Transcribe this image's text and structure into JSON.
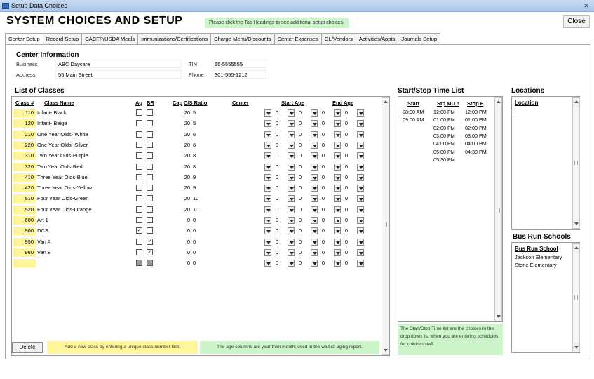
{
  "window": {
    "title": "Setup Data Choices",
    "close_glyph": "✕"
  },
  "header": {
    "title": "SYSTEM CHOICES AND SETUP",
    "hint": "Please click the Tab Headings to see additional setup choices.",
    "close_label": "Close"
  },
  "tabs": [
    {
      "label": "Center Setup",
      "active": true
    },
    {
      "label": "Record Setup"
    },
    {
      "label": "CACFP/USDA Meals"
    },
    {
      "label": "Immunizations/Certifications"
    },
    {
      "label": "Charge Menu/Discounts"
    },
    {
      "label": "Center Expenses"
    },
    {
      "label": "GL/Vendors"
    },
    {
      "label": "Activities/Appts"
    },
    {
      "label": "Journals Setup"
    }
  ],
  "center_info": {
    "heading": "Center Information",
    "business_label": "Business",
    "business": "ABC Daycare",
    "address_label": "Address",
    "address": "55 Main Street",
    "tin_label": "TIN",
    "tin": "55-5555555",
    "phone_label": "Phone",
    "phone": "301-555-1212"
  },
  "classes": {
    "heading": "List of Classes",
    "columns": {
      "class_num": "Class #",
      "class_name": "Class Name",
      "ag": "Ag",
      "br": "BR",
      "cap": "Cap",
      "ratio": "C/S Ratio",
      "center": "Center",
      "start_age": "Start Age",
      "end_age": "End Age"
    },
    "rows": [
      {
        "num": "110",
        "name": "Infant- Black",
        "ag": false,
        "br": false,
        "cap": "20",
        "ratio": "5",
        "sa_y": "0",
        "sa_m": "0",
        "ea_y": "0",
        "ea_m": "0"
      },
      {
        "num": "120",
        "name": "Infant- Beige",
        "ag": false,
        "br": false,
        "cap": "20",
        "ratio": "5",
        "sa_y": "0",
        "sa_m": "0",
        "ea_y": "0",
        "ea_m": "0"
      },
      {
        "num": "210",
        "name": "One Year Olds- White",
        "ag": false,
        "br": false,
        "cap": "20",
        "ratio": "6",
        "sa_y": "0",
        "sa_m": "0",
        "ea_y": "0",
        "ea_m": "0"
      },
      {
        "num": "220",
        "name": "One Year Olds- Silver",
        "ag": false,
        "br": false,
        "cap": "20",
        "ratio": "6",
        "sa_y": "0",
        "sa_m": "0",
        "ea_y": "0",
        "ea_m": "0"
      },
      {
        "num": "310",
        "name": "Two Year Olds-Purple",
        "ag": false,
        "br": false,
        "cap": "20",
        "ratio": "8",
        "sa_y": "0",
        "sa_m": "0",
        "ea_y": "0",
        "ea_m": "0"
      },
      {
        "num": "320",
        "name": "Two Year Olds-Red",
        "ag": false,
        "br": false,
        "cap": "20",
        "ratio": "8",
        "sa_y": "0",
        "sa_m": "0",
        "ea_y": "0",
        "ea_m": "0"
      },
      {
        "num": "410",
        "name": "Three Year Olds-Blue",
        "ag": false,
        "br": false,
        "cap": "20",
        "ratio": "9",
        "sa_y": "0",
        "sa_m": "0",
        "ea_y": "0",
        "ea_m": "0"
      },
      {
        "num": "420",
        "name": "Three Year Olds-Yellow",
        "ag": false,
        "br": false,
        "cap": "20",
        "ratio": "9",
        "sa_y": "0",
        "sa_m": "0",
        "ea_y": "0",
        "ea_m": "0"
      },
      {
        "num": "510",
        "name": "Four Year Olds-Green",
        "ag": false,
        "br": false,
        "cap": "20",
        "ratio": "10",
        "sa_y": "0",
        "sa_m": "0",
        "ea_y": "0",
        "ea_m": "0"
      },
      {
        "num": "520",
        "name": "Four Year Olds-Orange",
        "ag": false,
        "br": false,
        "cap": "20",
        "ratio": "10",
        "sa_y": "0",
        "sa_m": "0",
        "ea_y": "0",
        "ea_m": "0"
      },
      {
        "num": "600",
        "name": "Art 1",
        "ag": false,
        "br": false,
        "cap": "0",
        "ratio": "0",
        "sa_y": "0",
        "sa_m": "0",
        "ea_y": "0",
        "ea_m": "0"
      },
      {
        "num": "900",
        "name": "DCS",
        "ag": true,
        "br": false,
        "cap": "0",
        "ratio": "0",
        "sa_y": "0",
        "sa_m": "0",
        "ea_y": "0",
        "ea_m": "0"
      },
      {
        "num": "950",
        "name": "Van A",
        "ag": false,
        "br": true,
        "cap": "0",
        "ratio": "0",
        "sa_y": "0",
        "sa_m": "0",
        "ea_y": "0",
        "ea_m": "0"
      },
      {
        "num": "960",
        "name": "Van B",
        "ag": false,
        "br": true,
        "cap": "0",
        "ratio": "0",
        "sa_y": "0",
        "sa_m": "0",
        "ea_y": "0",
        "ea_m": "0"
      },
      {
        "num": "",
        "name": "",
        "ag": null,
        "br": null,
        "cap": "0",
        "ratio": "0",
        "sa_y": "0",
        "sa_m": "0",
        "ea_y": "0",
        "ea_m": "0"
      }
    ],
    "delete_label": "Delete",
    "note_add": "Add a new class by entering a unique class number first.",
    "note_age": "The age columns are year then month; used in the waitlist aging report."
  },
  "time_list": {
    "heading": "Start/Stop Time List",
    "col_start": "Start",
    "col_stop_mth": "Stp M-Th",
    "col_stop_f": "Stop F",
    "start": [
      "08:00 AM",
      "09:00 AM"
    ],
    "stop_mth": [
      "12:00 PM",
      "01:00 PM",
      "02:00 PM",
      "03:00 PM",
      "04:00 PM",
      "05:00 PM",
      "05:30 PM"
    ],
    "stop_f": [
      "12:00 PM",
      "01:00 PM",
      "02:00 PM",
      "03:00 PM",
      "04:00 PM",
      "04:30 PM"
    ],
    "note": "The Start/Stop Time list are the choices in the drop down list when you are entering schedules for children/staff."
  },
  "locations": {
    "heading": "Locations",
    "col": "Location",
    "items": []
  },
  "bus": {
    "heading": "Bus Run Schools",
    "col": "Bus Run School",
    "items": [
      "Jackson Elementary",
      "Stone Elementary"
    ]
  },
  "colors": {
    "yellow": "#fff59a",
    "green_note": "#ccf5c9",
    "titlebar": "#b8d0ef"
  }
}
